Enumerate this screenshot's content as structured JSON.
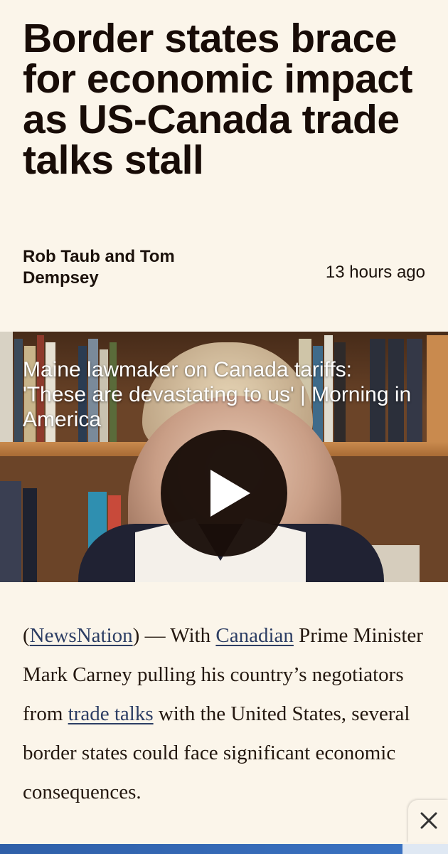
{
  "article": {
    "headline": "Border states brace for economic impact as US-Canada trade talks stall",
    "byline": "Rob Taub and Tom Dempsey",
    "timestamp": "13 hours ago"
  },
  "video": {
    "title": "Maine lawmaker on Canada tariffs: 'These are devastating to us' | Morning in America",
    "play_icon": "play-icon"
  },
  "body": {
    "paren_open": "(",
    "source_link": "NewsNation",
    "text_1": ") — With ",
    "canadian_link": "Canadian",
    "text_2": " Prime Minister Mark Carney pulling his country’s negotiators from ",
    "trade_talks_link": "trade talks",
    "text_3": " with the United States, several border states could face significant economic consequences."
  },
  "ui": {
    "close_icon": "close-icon",
    "accent_link_color": "#2d3e64",
    "background_color": "#fbf5ea"
  }
}
